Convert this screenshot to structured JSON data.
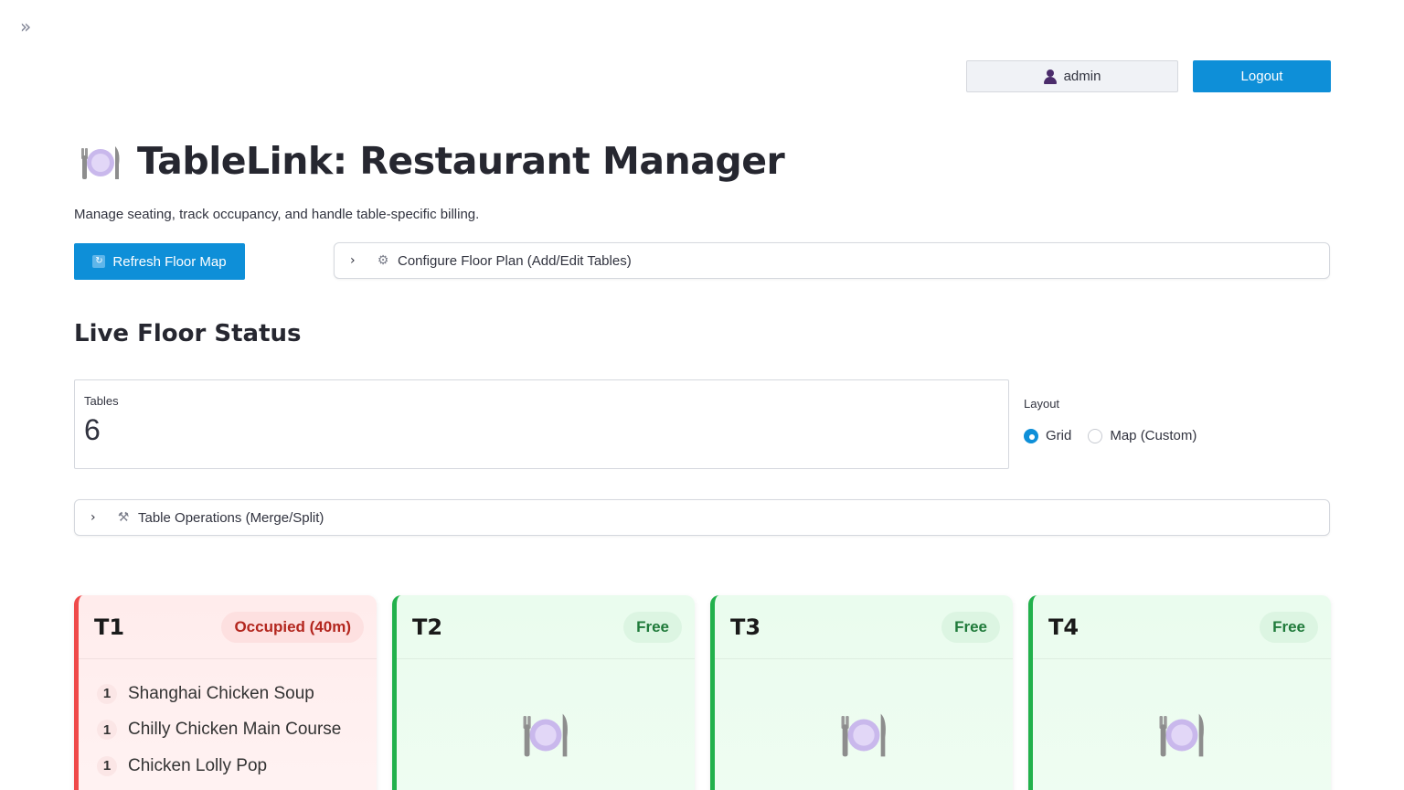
{
  "header": {
    "username": "admin",
    "logout_label": "Logout"
  },
  "page": {
    "title": "TableLink: Restaurant Manager",
    "subtitle": "Manage seating, track occupancy, and handle table-specific billing.",
    "refresh_label": "Refresh Floor Map",
    "config_expander_label": "Configure Floor Plan (Add/Edit Tables)",
    "section_title": "Live Floor Status",
    "ops_expander_label": "Table Operations (Merge/Split)"
  },
  "metric": {
    "label": "Tables",
    "value": "6"
  },
  "layout": {
    "label": "Layout",
    "options": [
      "Grid",
      "Map (Custom)"
    ],
    "selected": "Grid"
  },
  "tables": [
    {
      "name": "T1",
      "status": "Occupied (40m)",
      "items": [
        {
          "qty": "1",
          "name": "Shanghai Chicken Soup"
        },
        {
          "qty": "1",
          "name": "Chilly Chicken Main Course"
        },
        {
          "qty": "1",
          "name": "Chicken Lolly Pop"
        }
      ]
    },
    {
      "name": "T2",
      "status": "Free",
      "items": []
    },
    {
      "name": "T3",
      "status": "Free",
      "items": []
    },
    {
      "name": "T4",
      "status": "Free",
      "items": []
    }
  ],
  "colors": {
    "primary": "#0e8fd8",
    "occupied_accent": "#ef4a4a",
    "free_accent": "#22b14c"
  }
}
